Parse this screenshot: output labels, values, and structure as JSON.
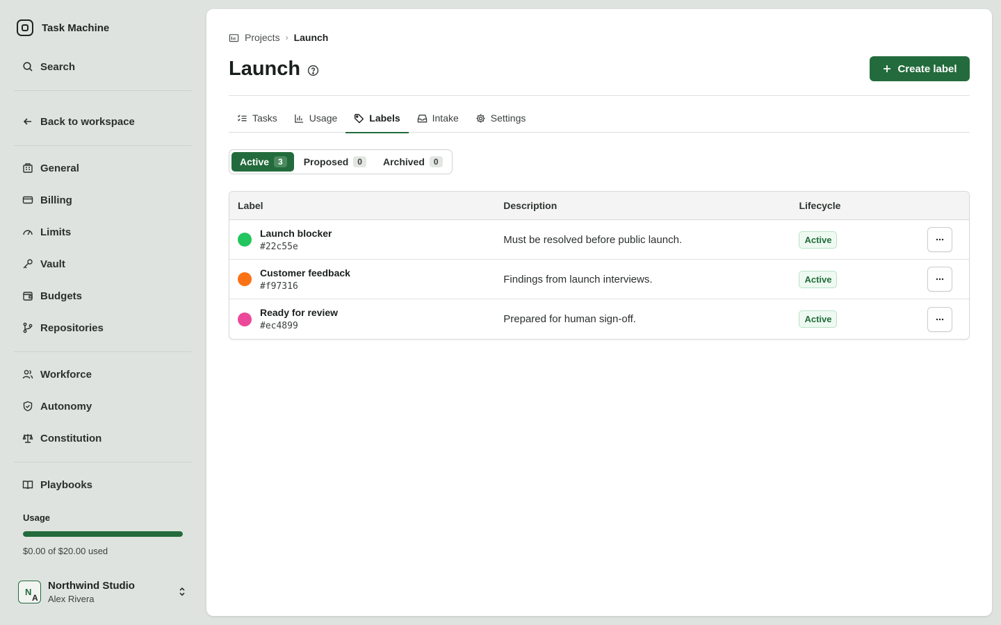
{
  "app": {
    "name": "Task Machine"
  },
  "sidebar": {
    "search_label": "Search",
    "back_label": "Back to workspace",
    "group1": [
      {
        "label": "General",
        "icon": "building-icon"
      },
      {
        "label": "Billing",
        "icon": "credit-card-icon"
      },
      {
        "label": "Limits",
        "icon": "gauge-icon"
      },
      {
        "label": "Vault",
        "icon": "key-icon"
      },
      {
        "label": "Budgets",
        "icon": "wallet-icon"
      },
      {
        "label": "Repositories",
        "icon": "git-branch-icon"
      }
    ],
    "group2": [
      {
        "label": "Workforce",
        "icon": "users-icon"
      },
      {
        "label": "Autonomy",
        "icon": "shield-check-icon"
      },
      {
        "label": "Constitution",
        "icon": "scale-icon"
      }
    ],
    "group3": [
      {
        "label": "Playbooks",
        "icon": "book-icon"
      }
    ],
    "usage": {
      "title": "Usage",
      "text": "$0.00 of $20.00 used",
      "fraction": 1.0
    },
    "account": {
      "org": "Northwind Studio",
      "user": "Alex Rivera",
      "avatar_letter_1": "N",
      "avatar_letter_2": "A"
    }
  },
  "breadcrumb": {
    "parent": "Projects",
    "current": "Launch"
  },
  "page": {
    "title": "Launch",
    "create_button": "Create label"
  },
  "tabs": [
    {
      "label": "Tasks",
      "icon": "list-check-icon",
      "active": false
    },
    {
      "label": "Usage",
      "icon": "bar-chart-icon",
      "active": false
    },
    {
      "label": "Labels",
      "icon": "tag-icon",
      "active": true
    },
    {
      "label": "Intake",
      "icon": "inbox-icon",
      "active": false
    },
    {
      "label": "Settings",
      "icon": "gear-icon",
      "active": false
    }
  ],
  "filters": [
    {
      "label": "Active",
      "count": "3",
      "active": true
    },
    {
      "label": "Proposed",
      "count": "0",
      "active": false
    },
    {
      "label": "Archived",
      "count": "0",
      "active": false
    }
  ],
  "table": {
    "headers": {
      "label": "Label",
      "description": "Description",
      "lifecycle": "Lifecycle"
    },
    "rows": [
      {
        "name": "Launch blocker",
        "hex": "#22c55e",
        "color": "#22c55e",
        "description": "Must be resolved before public launch.",
        "lifecycle": "Active"
      },
      {
        "name": "Customer feedback",
        "hex": "#f97316",
        "color": "#f97316",
        "description": "Findings from launch interviews.",
        "lifecycle": "Active"
      },
      {
        "name": "Ready for review",
        "hex": "#ec4899",
        "color": "#ec4899",
        "description": "Prepared for human sign-off.",
        "lifecycle": "Active"
      }
    ]
  },
  "colors": {
    "accent": "#236b3c",
    "sidebar_bg": "#dfe3df"
  }
}
